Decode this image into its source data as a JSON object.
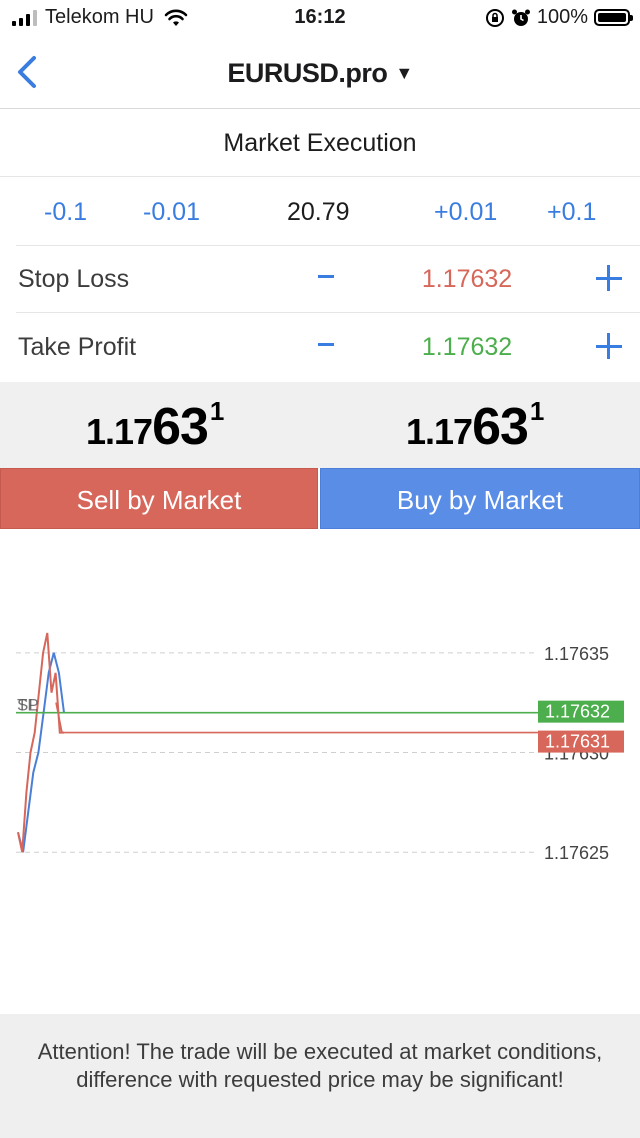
{
  "status_bar": {
    "carrier": "Telekom HU",
    "time": "16:12",
    "battery": "100%"
  },
  "nav": {
    "title": "EURUSD.pro",
    "caret": "▼",
    "back_icon": "chevron-left-icon"
  },
  "execution_type": "Market Execution",
  "volume": {
    "dec_large": "-0.1",
    "dec_small": "-0.01",
    "value": "20.79",
    "inc_small": "+0.01",
    "inc_large": "+0.1"
  },
  "stop_loss": {
    "label": "Stop Loss",
    "value": "1.17632",
    "color": "#d6675a"
  },
  "take_profit": {
    "label": "Take Profit",
    "value": "1.17632",
    "color": "#4cae4c"
  },
  "prices": {
    "sell": {
      "small": "1.17",
      "big": "63",
      "sup": "1"
    },
    "buy": {
      "small": "1.17",
      "big": "63",
      "sup": "1"
    }
  },
  "buttons": {
    "sell": "Sell by Market",
    "buy": "Buy by Market",
    "sell_color": "#d6675a",
    "buy_color": "#5a8de6"
  },
  "chart_data": {
    "type": "line",
    "y_ticks": [
      "1.17635",
      "1.17630",
      "1.17625"
    ],
    "ylim": [
      1.17621,
      1.17638
    ],
    "series": [
      {
        "color": "#4a7fd6",
        "values": [
          1.17626,
          1.17625,
          1.17627,
          1.17629,
          1.1763,
          1.17632,
          1.17634,
          1.17635,
          1.17634,
          1.17632
        ]
      },
      {
        "color": "#d6675a",
        "values": [
          1.17626,
          1.17625,
          1.17628,
          1.1763,
          1.17631,
          1.17633,
          1.17635,
          1.17636,
          1.17633,
          1.17634,
          1.17631,
          1.17631
        ]
      }
    ],
    "lines": [
      {
        "label": "1.17632",
        "value": 1.17632,
        "color": "#4cae4c"
      },
      {
        "label": "1.17631",
        "value": 1.17631,
        "color": "#d6675a"
      }
    ],
    "markers": [
      "SL",
      "TP"
    ],
    "grid": "dashed horizontal"
  },
  "notice": "Attention! The trade will be executed at market conditions, difference with requested price may be significant!"
}
